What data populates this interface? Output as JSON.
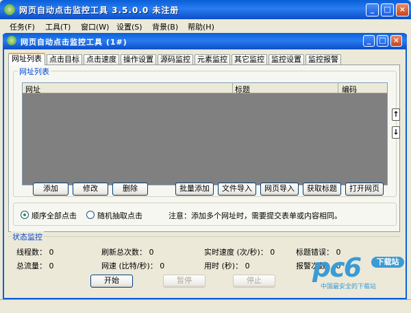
{
  "window": {
    "title": "网页自动点击监控工具  3.5.0.0  未注册",
    "minimize": "_",
    "maximize": "□",
    "close": "×"
  },
  "menu": [
    "任务(F)",
    "工具(T)",
    "窗口(W)",
    "设置(S)",
    "背景(B)",
    "帮助(H)"
  ],
  "child": {
    "title": "网页自动点击监控工具   (1#)"
  },
  "tabs": [
    "网址列表",
    "点击目标",
    "点击速度",
    "操作设置",
    "源码监控",
    "元素监控",
    "其它监控",
    "监控设置",
    "监控报警"
  ],
  "url_list": {
    "legend": "网址列表",
    "columns": [
      "网址",
      "标题",
      "编码"
    ],
    "up": "↑",
    "down": "↓",
    "buttons": [
      "添加",
      "修改",
      "删除",
      "批量添加",
      "文件导入",
      "网页导入",
      "获取标题",
      "打开网页"
    ]
  },
  "mode": {
    "option_sequential": "顺序全部点击",
    "option_random": "随机抽取点击",
    "selected": "顺序全部点击",
    "note": "注意：添加多个网址时，需要提交表单或内容相同。"
  },
  "status": {
    "legend": "状态监控",
    "threads": "线程数：  0",
    "refresh_total": "刷新总次数：  0",
    "speed": "实时速度 (次/秒)：  0",
    "title_errors": "标题错误：  0",
    "traffic": "总流量：  0",
    "net_speed": "网速 (比特/秒)：  0",
    "elapsed": "用时 (秒)：  0",
    "alarms": "报警次数：  0"
  },
  "controls": {
    "start": "开始",
    "pause": "暂停",
    "stop": "停止"
  },
  "watermark": {
    "logo": "pc6",
    "badge": "下载站",
    "tagline": "中国最安全的下载站"
  },
  "colors": {
    "titlebar": "#0a5fd8",
    "accent_tab": "#f0a830",
    "legend_text": "#0046d5"
  }
}
